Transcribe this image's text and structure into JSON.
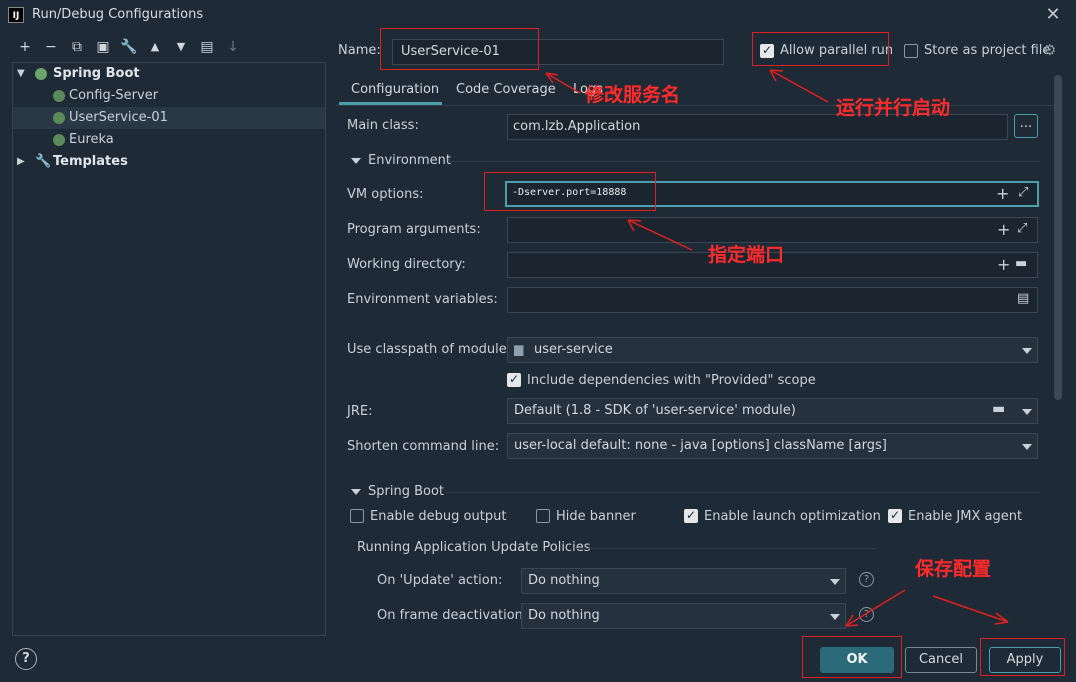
{
  "window": {
    "title": "Run/Debug Configurations",
    "app_icon_text": "IJ"
  },
  "tree": {
    "root_label": "Spring Boot",
    "items": [
      {
        "label": "Config-Server"
      },
      {
        "label": "UserService-01"
      },
      {
        "label": "Eureka"
      }
    ],
    "templates_label": "Templates"
  },
  "name_field": {
    "label": "Name:",
    "value": "UserService-01"
  },
  "allow_parallel": {
    "label": "Allow parallel run",
    "checked": true
  },
  "store_project": {
    "label": "Store as project file",
    "checked": false
  },
  "tabs": [
    {
      "label": "Configuration",
      "active": true
    },
    {
      "label": "Code Coverage",
      "active": false
    },
    {
      "label": "Logs",
      "active": false
    }
  ],
  "main_class": {
    "label": "Main class:",
    "value": "com.lzb.Application",
    "browse_label": "..."
  },
  "environment_section": "Environment",
  "vm_options": {
    "label": "VM options:",
    "value": "-Dserver.port=18888"
  },
  "program_arguments": {
    "label": "Program arguments:",
    "value": ""
  },
  "working_directory": {
    "label": "Working directory:",
    "value": ""
  },
  "environment_variables": {
    "label": "Environment variables:",
    "value": ""
  },
  "classpath_module": {
    "label": "Use classpath of module:",
    "value": "user-service"
  },
  "include_provided": {
    "label": "Include dependencies with \"Provided\" scope",
    "checked": true
  },
  "jre": {
    "label": "JRE:",
    "value": "Default (1.8 - SDK of 'user-service' module)"
  },
  "shorten_cmd": {
    "label": "Shorten command line:",
    "value": "user-local default: none - java [options] className [args]"
  },
  "spring_boot_section": "Spring Boot",
  "spring_options": [
    {
      "label": "Enable debug output",
      "checked": false
    },
    {
      "label": "Hide banner",
      "checked": false
    },
    {
      "label": "Enable launch optimization",
      "checked": true
    },
    {
      "label": "Enable JMX agent",
      "checked": true
    }
  ],
  "update_policies": {
    "title": "Running Application Update Policies",
    "on_update_label": "On 'Update' action:",
    "on_update_value": "Do nothing",
    "on_frame_label": "On frame deactivation:",
    "on_frame_value": "Do nothing"
  },
  "buttons": {
    "ok": "OK",
    "cancel": "Cancel",
    "apply": "Apply",
    "help": "?"
  },
  "annotations": {
    "rename": "修改服务名",
    "parallel": "运行并行启动",
    "port": "指定端口",
    "save": "保存配置"
  },
  "colors": {
    "accent": "#4c9fa8",
    "annotation": "#ff2a2a",
    "background": "#1e2a35"
  }
}
